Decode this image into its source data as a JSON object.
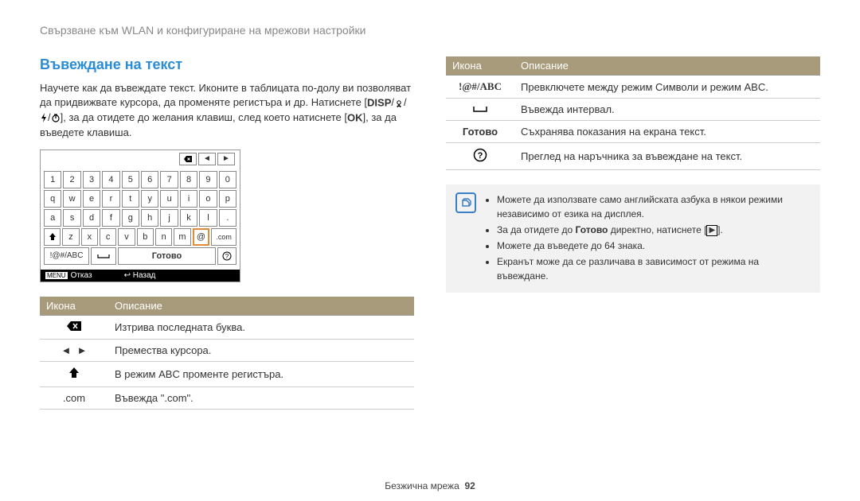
{
  "header_path": "Свързване към WLAN и конфигуриране на мрежови настройки",
  "section_title": "Въвеждане на текст",
  "intro_part1": "Научете как да въвеждате текст. Иконите в таблицата по-долу ви позволяват да придвижвате курсора, да променяте регистъра и др. Натиснете [",
  "intro_disp": "DISP",
  "intro_part2": "], за да отидете до желания клавиш, след което натиснете [",
  "intro_ok": "OK",
  "intro_part3": "], за да въведете клавиша.",
  "keyboard": {
    "row_nums": [
      "1",
      "2",
      "3",
      "4",
      "5",
      "6",
      "7",
      "8",
      "9",
      "0"
    ],
    "row_q": [
      "q",
      "w",
      "e",
      "r",
      "t",
      "y",
      "u",
      "i",
      "o",
      "p"
    ],
    "row_a": [
      "a",
      "s",
      "d",
      "f",
      "g",
      "h",
      "j",
      "k",
      "l",
      "."
    ],
    "row_z": [
      "z",
      "x",
      "c",
      "v",
      "b",
      "n",
      "m",
      "@",
      ".com"
    ],
    "shift": "⇧",
    "mode_label": "!@#/ABC",
    "done_label": "Готово",
    "help_label": "?",
    "space_label": "␣",
    "cancel_label": "Отказ",
    "back_label": "Назад",
    "menu_tag": "MENU"
  },
  "table1": {
    "head_icon": "Икона",
    "head_desc": "Описание",
    "rows": [
      {
        "icon_type": "backspace",
        "desc": "Изтрива последната буква."
      },
      {
        "icon_type": "arrows",
        "desc": "Премества курсора."
      },
      {
        "icon_type": "shift",
        "desc": "В режим ABC променте регистъра."
      },
      {
        "icon_type": "com",
        "icon_text": ".com",
        "desc": "Въвежда \".com\"."
      }
    ]
  },
  "table2": {
    "head_icon": "Икона",
    "head_desc": "Описание",
    "rows": [
      {
        "icon_type": "mode",
        "icon_text": "!@#/ABC",
        "desc": "Превключете между режим Символи и режим ABC."
      },
      {
        "icon_type": "space",
        "desc": "Въвежда интервал."
      },
      {
        "icon_type": "done",
        "icon_text": "Готово",
        "desc": "Съхранява показания на екрана текст."
      },
      {
        "icon_type": "help",
        "desc": "Преглед на наръчника за въвеждане на текст."
      }
    ]
  },
  "notes": {
    "n1": "Можете да използвате само английската азбука в някои режими независимо от езика на дисплея.",
    "n2a": "За да отидете до ",
    "n2b": "Готово",
    "n2c": " директно, натиснете [",
    "n2d": "].",
    "n3": "Можете да въведете до 64 знака.",
    "n4": "Екранът може да се различава в зависимост от режима на въвеждане."
  },
  "footer_section": "Безжична мрежа",
  "footer_page": "92"
}
